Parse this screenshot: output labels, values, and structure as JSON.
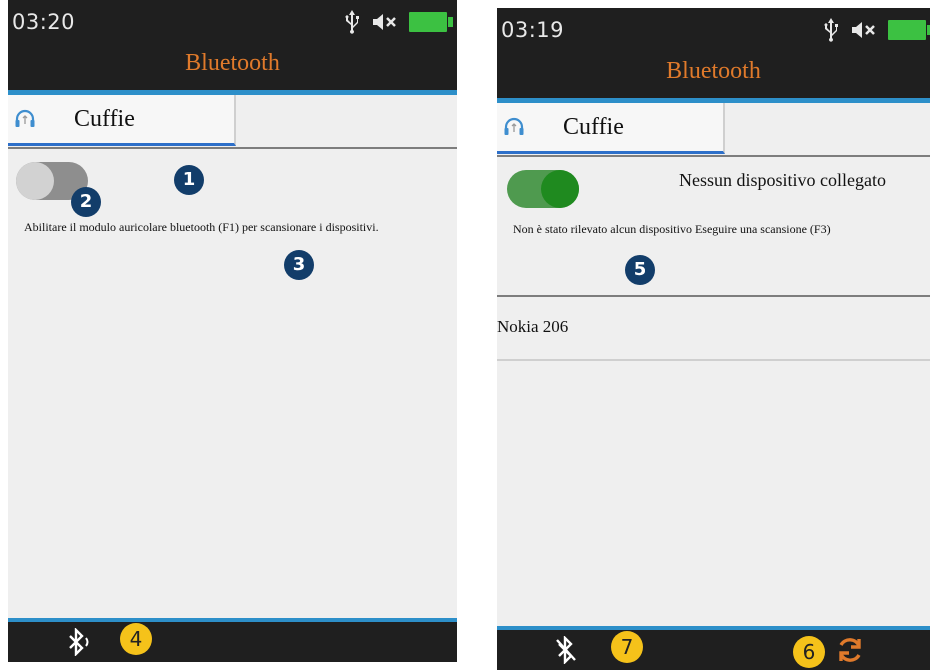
{
  "left": {
    "time": "03:20",
    "title": "Bluetooth",
    "tab_label": "Cuffie",
    "message": "Abilitare il modulo auricolare bluetooth (F1) per scansionare i dispositivi.",
    "callouts": [
      "1",
      "2",
      "3",
      "4"
    ],
    "toggle_state": "off"
  },
  "right": {
    "time": "03:19",
    "title": "Bluetooth",
    "tab_label": "Cuffie",
    "status": "Nessun dispositivo collegato",
    "message": "Non è stato rilevato alcun dispositivo Eseguire una scansione (F3)",
    "device_name": "Nokia 206",
    "callouts": [
      "5",
      "6",
      "7"
    ],
    "toggle_state": "on"
  },
  "colors": {
    "title": "#e07a2b",
    "accent_blue": "#2d8fc9",
    "battery": "#3cc142",
    "callout_dark": "#123d6a",
    "callout_yellow": "#f5c21a",
    "toggle_on": "#1f8a1f"
  },
  "icons": {
    "status": [
      "usb-icon",
      "speaker-muted-icon",
      "battery-icon"
    ],
    "tab": "headphones-icon",
    "bottom_left": "bluetooth-search-icon",
    "bottom_right": [
      "bluetooth-disabled-icon",
      "refresh-icon"
    ]
  }
}
